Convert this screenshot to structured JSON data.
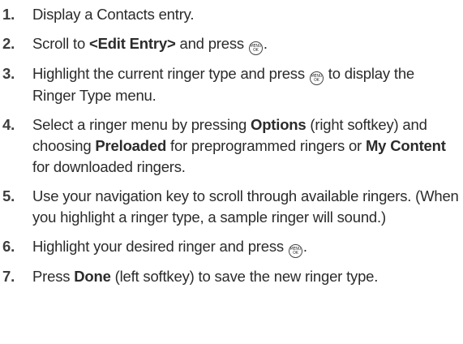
{
  "menu_key": {
    "line1": "MENU",
    "line2": "OK"
  },
  "steps": [
    {
      "num": "1.",
      "text": "Display a Contacts entry."
    },
    {
      "num": "2.",
      "a": "Scroll to ",
      "b": "<Edit Entry>",
      "c": " and press ",
      "d": "."
    },
    {
      "num": "3.",
      "a": "Highlight the current ringer type and press ",
      "b": " to display the Ringer Type menu."
    },
    {
      "num": "4.",
      "a": "Select a ringer menu by pressing ",
      "b": "Options",
      "c": " (right softkey) and choosing ",
      "d": "Preloaded",
      "e": " for preprogrammed ringers or ",
      "f": "My Content",
      "g": " for downloaded ringers."
    },
    {
      "num": "5.",
      "text": "Use your navigation key to scroll through available ringers. (When you highlight a ringer type, a sample ringer will sound.)"
    },
    {
      "num": "6.",
      "a": "Highlight your desired ringer and press ",
      "b": "."
    },
    {
      "num": "7.",
      "a": "Press ",
      "b": "Done",
      "c": " (left softkey) to save the new ringer type."
    }
  ]
}
